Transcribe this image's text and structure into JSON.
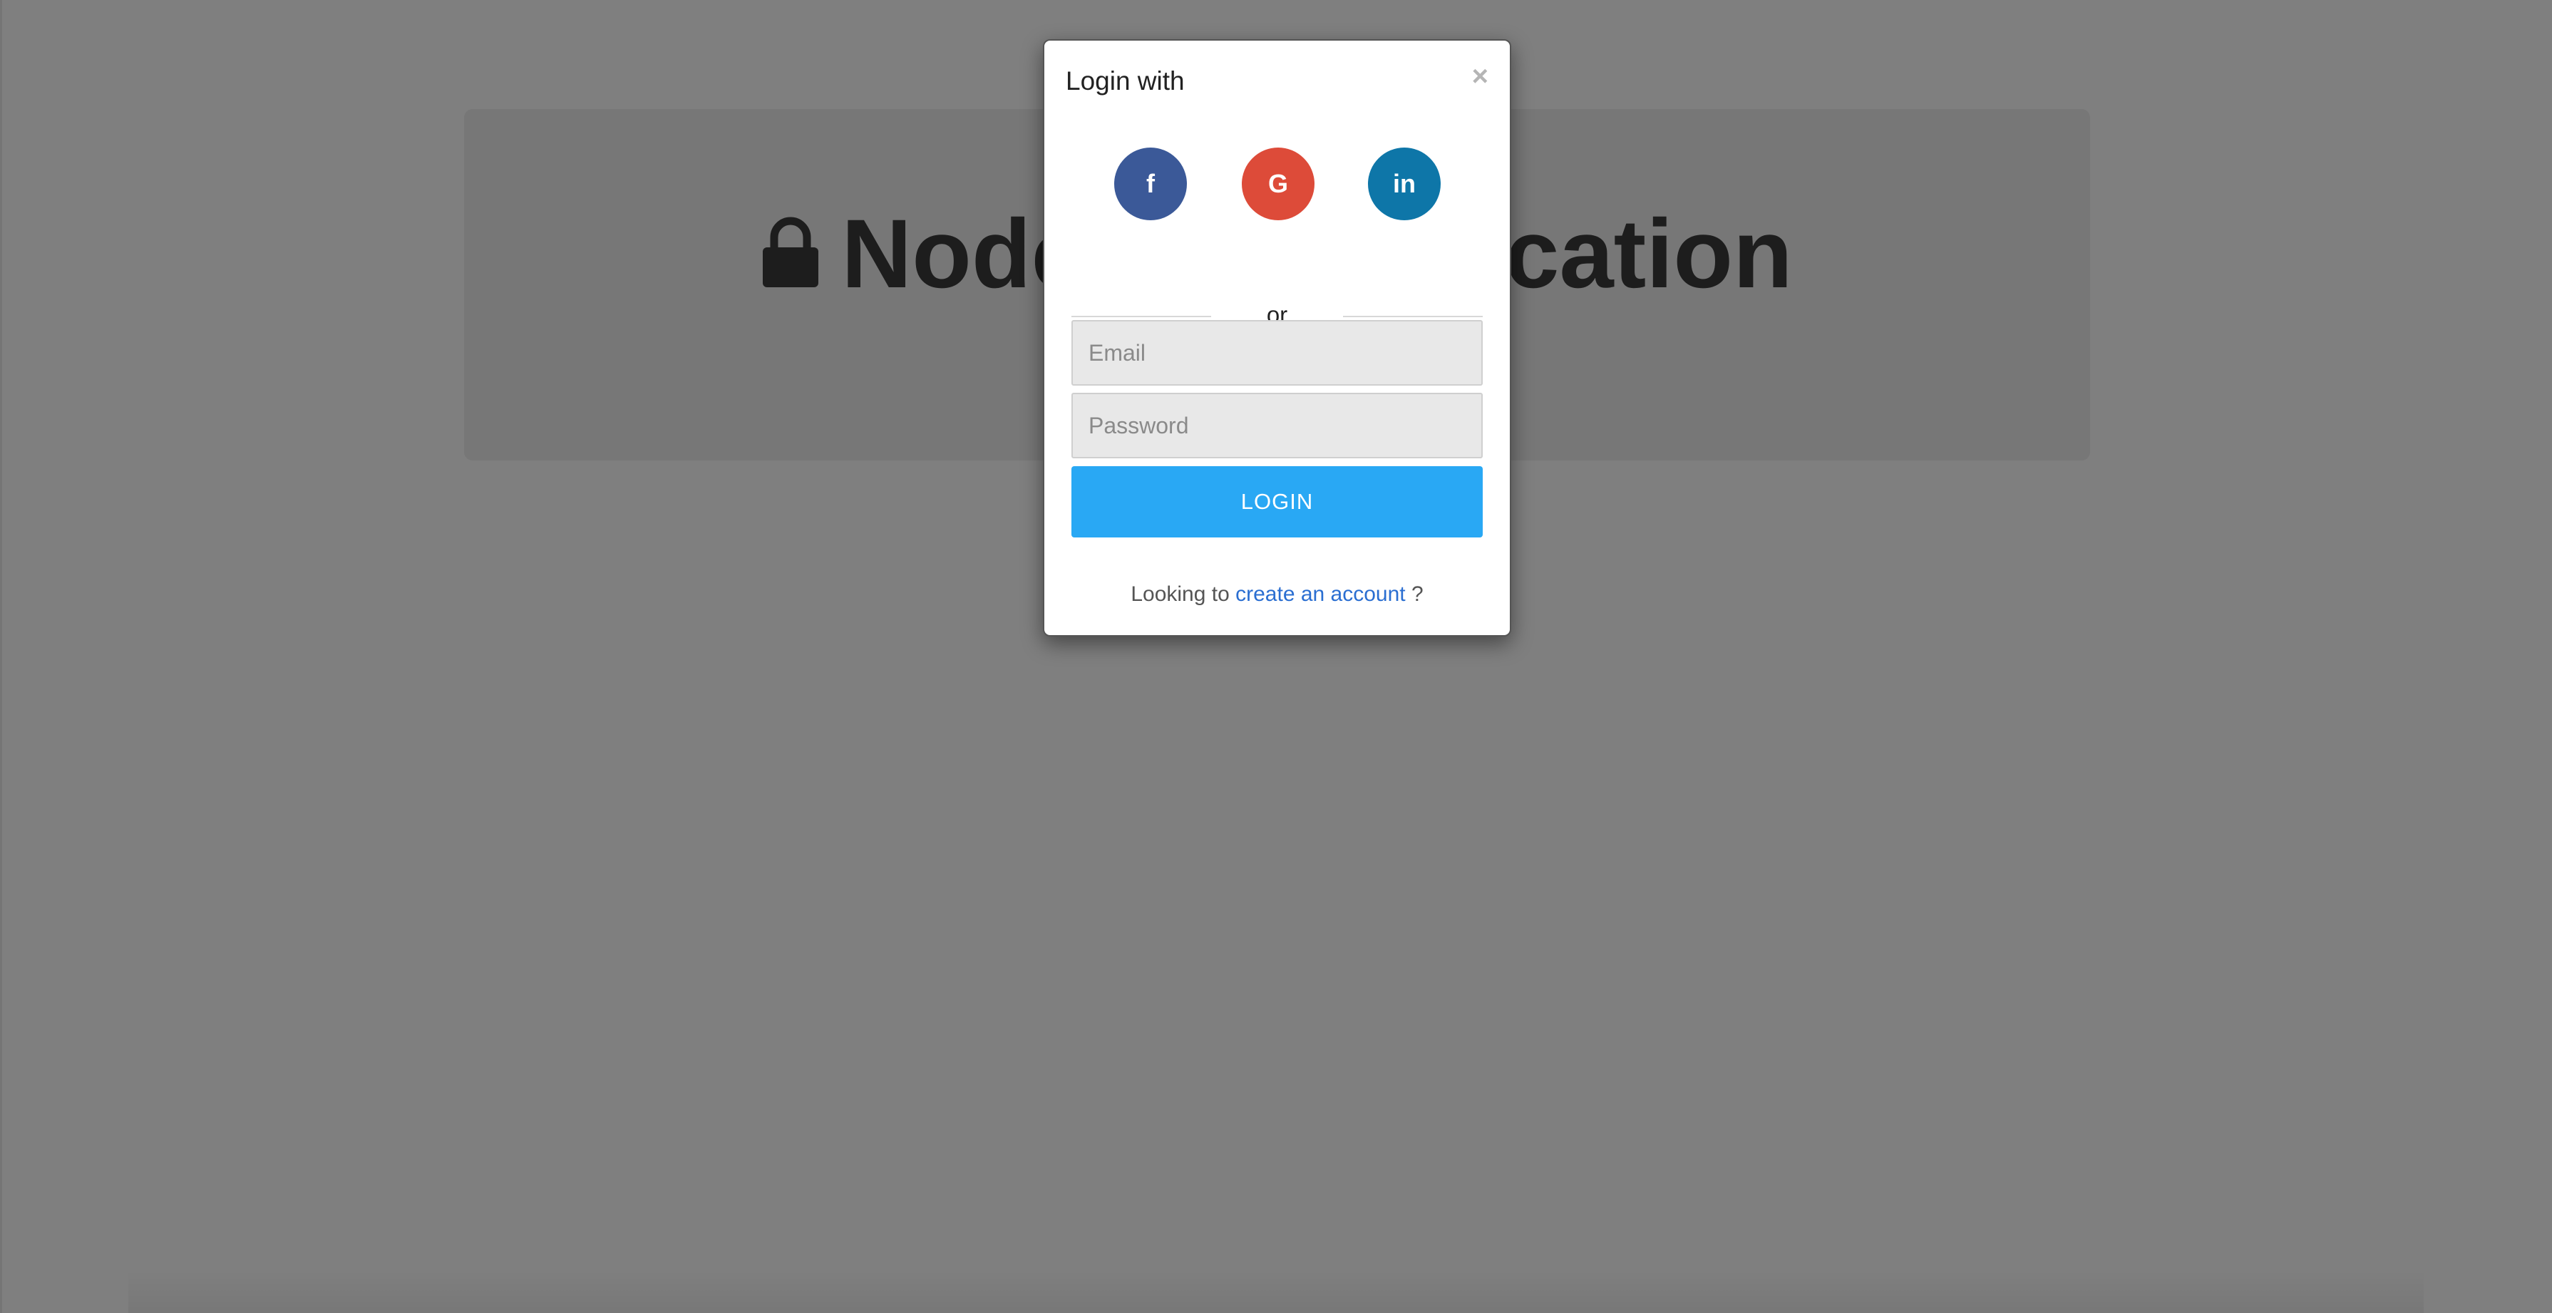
{
  "background": {
    "hero_title": "Node Authentication"
  },
  "modal": {
    "title": "Login with",
    "close_symbol": "×",
    "socials": [
      {
        "name": "facebook",
        "glyph": "f",
        "color": "#3b5998",
        "icon": "facebook-icon"
      },
      {
        "name": "google",
        "glyph": "G",
        "color": "#dd4b39",
        "icon": "google-icon"
      },
      {
        "name": "linkedin",
        "glyph": "in",
        "color": "#0e76a8",
        "icon": "linkedin-icon"
      }
    ],
    "divider_text": "or",
    "email_placeholder": "Email",
    "password_placeholder": "Password",
    "login_label": "LOGIN",
    "footer_prefix": "Looking to",
    "footer_link": "create an account",
    "footer_suffix": "?"
  },
  "colors": {
    "login_button": "#29a8f4",
    "link": "#2a6ed1"
  }
}
